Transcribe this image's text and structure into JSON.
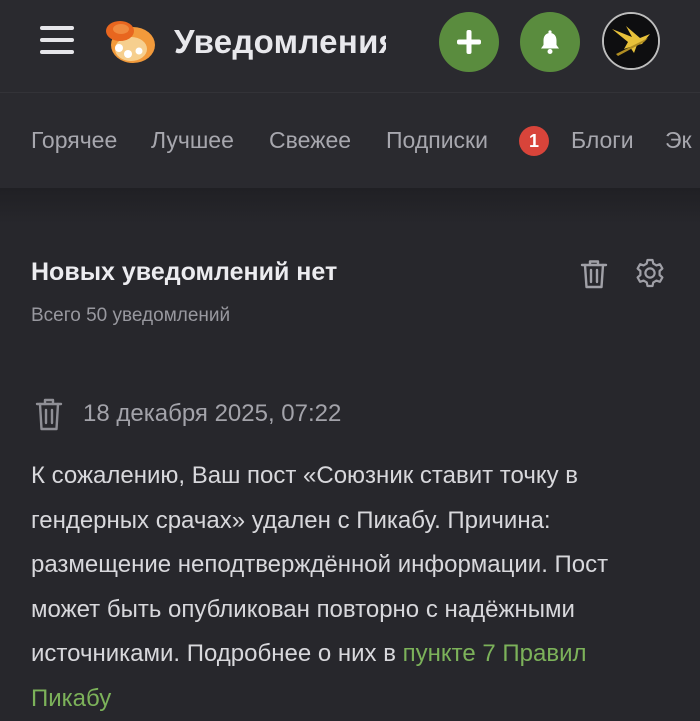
{
  "header": {
    "title": "Уведомления",
    "menu_icon": "hamburger-icon",
    "logo_icon": "pikabu-logo-icon",
    "add_icon": "plus-icon",
    "bell_icon": "bell-icon",
    "accent_color": "#5a8c3e"
  },
  "nav": {
    "items": [
      {
        "label": "Горячее"
      },
      {
        "label": "Лучшее"
      },
      {
        "label": "Свежее"
      },
      {
        "label": "Подписки",
        "badge": "1"
      },
      {
        "label": "Блоги"
      },
      {
        "label": "Эк"
      }
    ],
    "badge_color": "#d8443a"
  },
  "notifications": {
    "title": "Новых уведомлений нет",
    "subtitle": "Всего 50 уведомлений",
    "item": {
      "date": "18 декабря 2025, 07:22",
      "text": "К сожалению, Ваш пост «Союзник ставит точку в гендерных срачах» удален с Пикабу. Причина: размещение неподтверждённой информации. Пост может быть опубликован повторно с надёжными источниками. Подробнее о них в ",
      "link_text": "пункте 7 Правил Пикабу",
      "link_color": "#7cb25a"
    }
  }
}
